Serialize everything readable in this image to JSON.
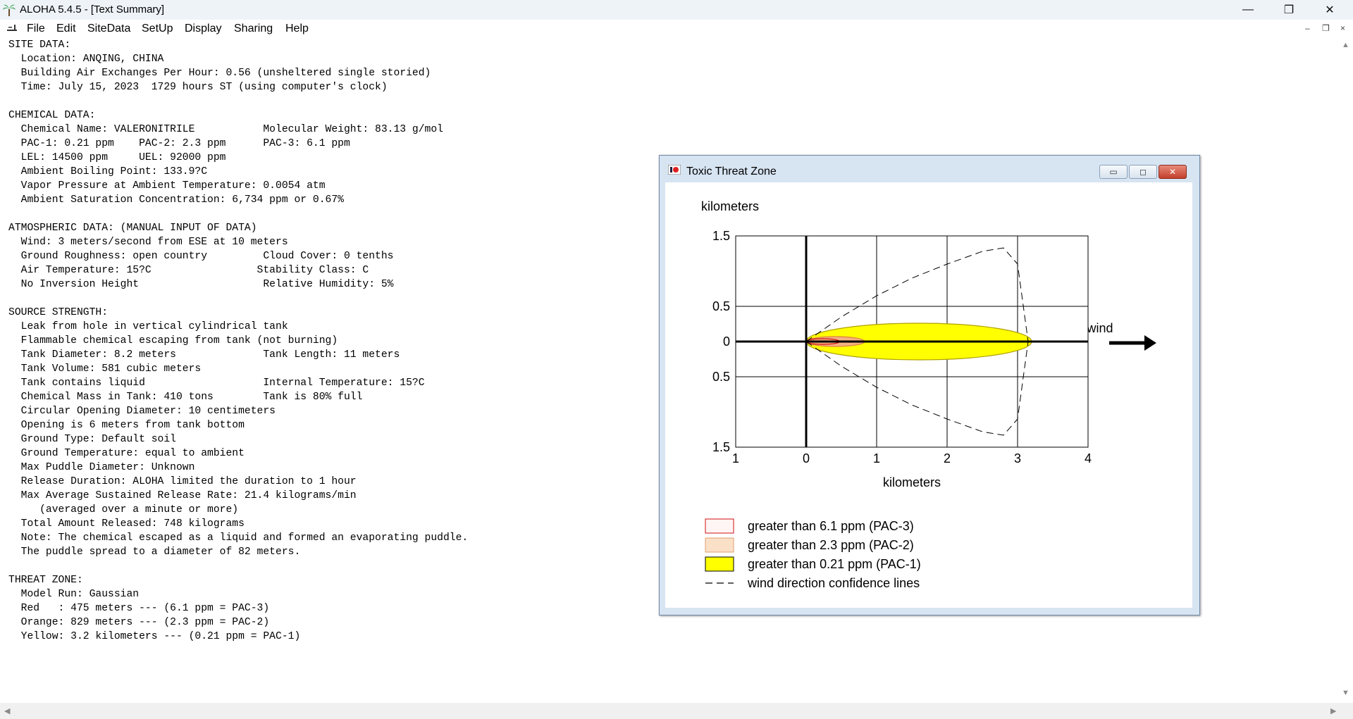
{
  "window": {
    "title": "ALOHA 5.4.5 - [Text Summary]",
    "minimize_glyph": "—",
    "maximize_glyph": "❐",
    "close_glyph": "✕"
  },
  "menu": [
    "File",
    "Edit",
    "SiteData",
    "SetUp",
    "Display",
    "Sharing",
    "Help"
  ],
  "mdi_buttons": [
    "–",
    "❐",
    "×"
  ],
  "summary_lines": [
    "SITE DATA:",
    "  Location: ANQING, CHINA",
    "  Building Air Exchanges Per Hour: 0.56 (unsheltered single storied)",
    "  Time: July 15, 2023  1729 hours ST (using computer's clock)",
    "",
    "CHEMICAL DATA:",
    "  Chemical Name: VALERONITRILE           Molecular Weight: 83.13 g/mol",
    "  PAC-1: 0.21 ppm    PAC-2: 2.3 ppm      PAC-3: 6.1 ppm",
    "  LEL: 14500 ppm     UEL: 92000 ppm",
    "  Ambient Boiling Point: 133.9?C",
    "  Vapor Pressure at Ambient Temperature: 0.0054 atm",
    "  Ambient Saturation Concentration: 6,734 ppm or 0.67%",
    "",
    "ATMOSPHERIC DATA: (MANUAL INPUT OF DATA)",
    "  Wind: 3 meters/second from ESE at 10 meters",
    "  Ground Roughness: open country         Cloud Cover: 0 tenths",
    "  Air Temperature: 15?C                 Stability Class: C",
    "  No Inversion Height                    Relative Humidity: 5%",
    "",
    "SOURCE STRENGTH:",
    "  Leak from hole in vertical cylindrical tank",
    "  Flammable chemical escaping from tank (not burning)",
    "  Tank Diameter: 8.2 meters              Tank Length: 11 meters",
    "  Tank Volume: 581 cubic meters",
    "  Tank contains liquid                   Internal Temperature: 15?C",
    "  Chemical Mass in Tank: 410 tons        Tank is 80% full",
    "  Circular Opening Diameter: 10 centimeters",
    "  Opening is 6 meters from tank bottom",
    "  Ground Type: Default soil",
    "  Ground Temperature: equal to ambient",
    "  Max Puddle Diameter: Unknown",
    "  Release Duration: ALOHA limited the duration to 1 hour",
    "  Max Average Sustained Release Rate: 21.4 kilograms/min",
    "     (averaged over a minute or more)",
    "  Total Amount Released: 748 kilograms",
    "  Note: The chemical escaped as a liquid and formed an evaporating puddle.",
    "  The puddle spread to a diameter of 82 meters.",
    "",
    "THREAT ZONE:",
    "  Model Run: Gaussian",
    "  Red   : 475 meters --- (6.1 ppm = PAC-3)",
    "  Orange: 829 meters --- (2.3 ppm = PAC-2)",
    "  Yellow: 3.2 kilometers --- (0.21 ppm = PAC-1)"
  ],
  "threat_window": {
    "title": "Toxic Threat Zone",
    "wind_label": "wind"
  },
  "chart_data": {
    "type": "threat-zone",
    "xlabel": "kilometers",
    "ylabel": "kilometers",
    "x_ticks": [
      "1",
      "0",
      "1",
      "2",
      "3",
      "4"
    ],
    "y_ticks": [
      "1.5",
      "0.5",
      "0",
      "0.5",
      "1.5"
    ],
    "xlim": [
      -1,
      4
    ],
    "ylim": [
      -1.5,
      1.5
    ],
    "grid": true,
    "zones": [
      {
        "name": "red",
        "level": "PAC-3",
        "ppm": 6.1,
        "length_km": 0.475,
        "half_width_km": 0.04,
        "color": "#e02020"
      },
      {
        "name": "orange",
        "level": "PAC-2",
        "ppm": 2.3,
        "length_km": 0.829,
        "half_width_km": 0.07,
        "color": "#f4b183"
      },
      {
        "name": "yellow",
        "level": "PAC-1",
        "ppm": 0.21,
        "length_km": 3.2,
        "half_width_km": 0.26,
        "color": "#ffff00"
      }
    ],
    "confidence_lines": {
      "x": [
        0,
        0.5,
        1,
        1.5,
        2,
        2.5,
        2.8,
        3.0,
        3.15
      ],
      "y_half_width": [
        0,
        0.35,
        0.65,
        0.9,
        1.1,
        1.28,
        1.33,
        1.1,
        0.0
      ]
    },
    "legend": [
      {
        "label": "greater than 6.1 ppm (PAC-3)",
        "swatch": "pac3"
      },
      {
        "label": "greater than 2.3 ppm (PAC-2)",
        "swatch": "pac2"
      },
      {
        "label": "greater than 0.21 ppm (PAC-1)",
        "swatch": "pac1"
      },
      {
        "label": "wind direction confidence lines",
        "swatch": "dashed"
      }
    ]
  }
}
